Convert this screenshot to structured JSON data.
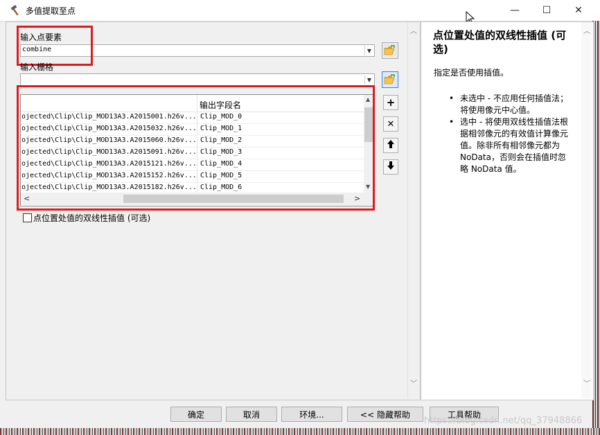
{
  "window": {
    "title": "多值提取至点",
    "minimize_glyph": "—",
    "maximize_glyph": "☐",
    "close_glyph": "✕"
  },
  "form": {
    "input_points_label": "输入点要素",
    "input_points_value": "combine",
    "input_rasters_label": "输入栅格",
    "input_rasters_value": "",
    "table": {
      "header_col1": "",
      "header_col2": "输出字段名",
      "rows": [
        {
          "raster": "ojected\\Clip\\Clip_MOD13A3.A2015001.h26v...",
          "field": "Clip_MOD_0"
        },
        {
          "raster": "ojected\\Clip\\Clip_MOD13A3.A2015032.h26v...",
          "field": "Clip_MOD_1"
        },
        {
          "raster": "ojected\\Clip\\Clip_MOD13A3.A2015060.h26v...",
          "field": "Clip_MOD_2"
        },
        {
          "raster": "ojected\\Clip\\Clip_MOD13A3.A2015091.h26v...",
          "field": "Clip_MOD_3"
        },
        {
          "raster": "ojected\\Clip\\Clip_MOD13A3.A2015121.h26v...",
          "field": "Clip_MOD_4"
        },
        {
          "raster": "ojected\\Clip\\Clip_MOD13A3.A2015152.h26v...",
          "field": "Clip_MOD_5"
        },
        {
          "raster": "ojected\\Clip\\Clip_MOD13A3.A2015182.h26v...",
          "field": "Clip_MOD_6"
        }
      ]
    },
    "side_buttons": {
      "add": "+",
      "remove": "✕",
      "up": "🡅",
      "down": "🡇"
    },
    "bilinear_checkbox_label": "点位置处值的双线性插值 (可选)"
  },
  "help": {
    "title": "点位置处值的双线性插值 (可选)",
    "description": "指定是否使用插值。",
    "items": [
      "未选中 - 不应用任何插值法；将使用像元中心值。",
      "选中 - 将使用双线性插值法根据相邻像元的有效值计算像元值。除非所有相邻像元都为 NoData，否则会在插值时忽略 NoData 值。"
    ]
  },
  "buttons": {
    "ok": "确定",
    "cancel": "取消",
    "environments": "环境...",
    "hide_help": "<< 隐藏帮助",
    "tool_help": "工具帮助"
  },
  "watermark": "https://blog.csdn.net/qq_37948866",
  "colors": {
    "highlight_red": "#e0191e",
    "active_blue": "#3c7fd6"
  }
}
